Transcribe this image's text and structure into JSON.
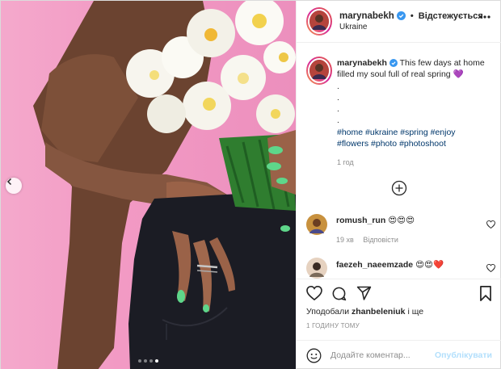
{
  "post": {
    "username": "marynabekh",
    "separator": "•",
    "follow_label": "Відстежується",
    "location": "Ukraine"
  },
  "caption": {
    "username": "marynabekh",
    "text": "This few days at home filled my soul full of real spring",
    "emoji": "💜",
    "dots": [
      ".",
      ".",
      ".",
      "."
    ],
    "hashtags": [
      "#home",
      "#ukraine",
      "#spring",
      "#enjoy",
      "#flowers",
      "#photo",
      "#photoshoot"
    ],
    "time": "1 год"
  },
  "comments": [
    {
      "username": "romush_run",
      "text": "😍😍😍",
      "time": "19 хв",
      "reply_label": "Відповісти"
    },
    {
      "username": "faezeh_naeemzade",
      "text": "😍😍❤️"
    }
  ],
  "likes": {
    "prefix": "Уподобали",
    "user": "zhanbeleniuk",
    "suffix": "і ще"
  },
  "time_ago": "1 ГОДИНУ ТОМУ",
  "comment_box": {
    "placeholder": "Додайте коментар...",
    "post_label": "Опублікувати"
  },
  "carousel": {
    "total": 4,
    "active_index": 3
  },
  "colors": {
    "photo_bg": "#f29ac4",
    "verified": "#3897f0",
    "hashtag": "#00376b",
    "post_disabled": "#b2dffc",
    "muted_text": "#8e8e8e"
  },
  "icons": [
    "chevron-left-icon",
    "verified-icon",
    "more-icon",
    "plus-circle-icon",
    "heart-icon",
    "comment-icon",
    "share-icon",
    "bookmark-icon",
    "emoji-icon"
  ]
}
